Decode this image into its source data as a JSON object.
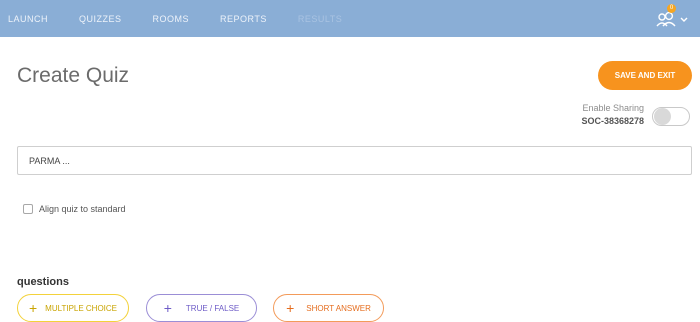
{
  "nav": {
    "items": [
      {
        "label": "LAUNCH",
        "enabled": true
      },
      {
        "label": "QUIZZES",
        "enabled": true
      },
      {
        "label": "ROOMS",
        "enabled": true
      },
      {
        "label": "REPORTS",
        "enabled": true
      },
      {
        "label": "RESULTS",
        "enabled": false
      }
    ],
    "user_icon": "user-icon",
    "badge_count": "0",
    "chevron_icon": "chevron-down-icon"
  },
  "page": {
    "title": "Create Quiz",
    "save_exit_label": "SAVE AND EXIT"
  },
  "sharing": {
    "label": "Enable Sharing",
    "code": "SOC-38368278",
    "enabled": false
  },
  "quiz_name": {
    "value": "PARMA ..."
  },
  "align": {
    "label": "Align quiz to standard",
    "checked": false
  },
  "questions": {
    "heading": "questions",
    "buttons": [
      {
        "label": "MULTIPLE CHOICE",
        "color": "#f3d23b"
      },
      {
        "label": "TRUE / FALSE",
        "color": "#9b8ed6"
      },
      {
        "label": "SHORT ANSWER",
        "color": "#f39b5a"
      }
    ]
  },
  "colors": {
    "navbar": "#8aaed6",
    "accent": "#f7931e"
  }
}
